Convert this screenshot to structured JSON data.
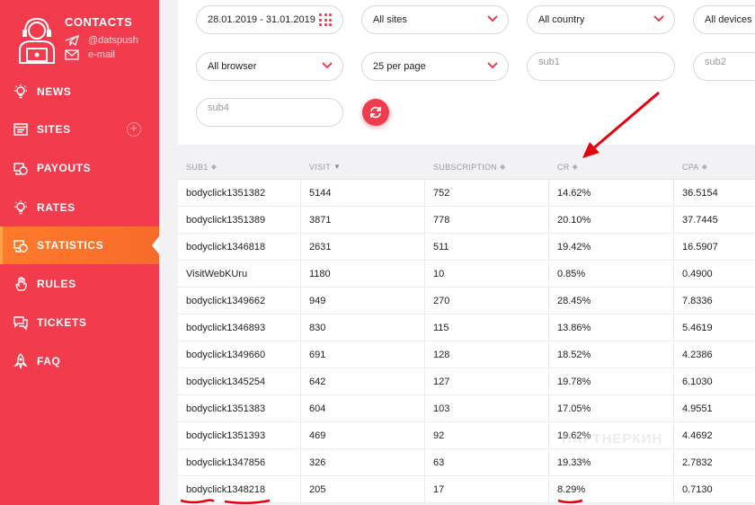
{
  "sidebar": {
    "contacts": {
      "title": "CONTACTS",
      "telegram": "@datspush",
      "email": "e-mail"
    },
    "items": [
      {
        "label": "NEWS",
        "icon": "bulb-icon"
      },
      {
        "label": "SITES",
        "icon": "sites-icon"
      },
      {
        "label": "PAYOUTS",
        "icon": "payouts-icon"
      },
      {
        "label": "RATES",
        "icon": "bulb-icon"
      },
      {
        "label": "STATISTICS",
        "icon": "statistics-icon",
        "active": true
      },
      {
        "label": "RULES",
        "icon": "hand-icon"
      },
      {
        "label": "TICKETS",
        "icon": "tickets-icon"
      },
      {
        "label": "FAQ",
        "icon": "rocket-icon"
      }
    ],
    "add_site_glyph": "+"
  },
  "filters": {
    "date_range": "28.01.2019 - 31.01.2019",
    "sites": "All sites",
    "country": "All country",
    "devices": "All devices",
    "browser": "All browser",
    "per_page": "25 per page",
    "sub1_placeholder": "sub1",
    "sub2_placeholder": "sub2",
    "sub4_placeholder": "sub4"
  },
  "table": {
    "headers": [
      "SUB1",
      "VISIT",
      "SUBSCRIPTION",
      "CR",
      "CPA"
    ],
    "rows": [
      [
        "bodyclick1351382",
        "5144",
        "752",
        "14.62%",
        "36.5154"
      ],
      [
        "bodyclick1351389",
        "3871",
        "778",
        "20.10%",
        "37.7445"
      ],
      [
        "bodyclick1346818",
        "2631",
        "511",
        "19.42%",
        "16.5907"
      ],
      [
        "VisitWebKUru",
        "1180",
        "10",
        "0.85%",
        "0.4900"
      ],
      [
        "bodyclick1349662",
        "949",
        "270",
        "28.45%",
        "7.8336"
      ],
      [
        "bodyclick1346893",
        "830",
        "115",
        "13.86%",
        "5.4619"
      ],
      [
        "bodyclick1349660",
        "691",
        "128",
        "18.52%",
        "4.2386"
      ],
      [
        "bodyclick1345254",
        "642",
        "127",
        "19.78%",
        "6.1030"
      ],
      [
        "bodyclick1351383",
        "604",
        "103",
        "17.05%",
        "4.9551"
      ],
      [
        "bodyclick1351393",
        "469",
        "92",
        "19.62%",
        "4.4692"
      ],
      [
        "bodyclick1347856",
        "326",
        "63",
        "19.33%",
        "2.7832"
      ],
      [
        "bodyclick1348218",
        "205",
        "17",
        "8.29%",
        "0.7130"
      ]
    ]
  },
  "watermark": "ПАРТНЕРКИН",
  "colors": {
    "brand": "#f23c4e",
    "active": "#ff7a2a",
    "annotation": "#e8000d"
  }
}
